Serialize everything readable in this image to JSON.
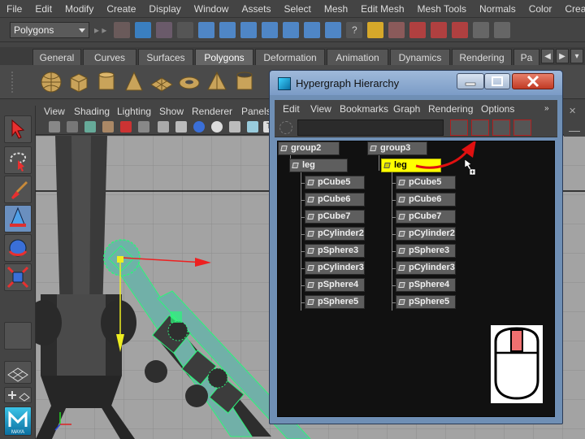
{
  "main_menu": [
    "File",
    "Edit",
    "Modify",
    "Create",
    "Display",
    "Window",
    "Assets",
    "Select",
    "Mesh",
    "Edit Mesh",
    "Mesh Tools",
    "Normals",
    "Color",
    "Create UVs"
  ],
  "status_line": {
    "menu_set": "Polygons"
  },
  "shelf": {
    "tabs": [
      "General",
      "Curves",
      "Surfaces",
      "Polygons",
      "Deformation",
      "Animation",
      "Dynamics",
      "Rendering",
      "Pa"
    ],
    "active_tab": "Polygons"
  },
  "viewport": {
    "menu": [
      "View",
      "Shading",
      "Lighting",
      "Show",
      "Renderer",
      "Panels"
    ]
  },
  "hypergraph": {
    "title": "Hypergraph Hierarchy",
    "menu": [
      "Edit",
      "View",
      "Bookmarks",
      "Graph",
      "Rendering",
      "Options"
    ],
    "left_tree": {
      "root": "group2",
      "child": "leg",
      "leaves": [
        "pCube5",
        "pCube6",
        "pCube7",
        "pCylinder2",
        "pSphere3",
        "pCylinder3",
        "pSphere4",
        "pSphere5"
      ]
    },
    "right_tree": {
      "root": "group3",
      "child": "leg",
      "leaves": [
        "pCube5",
        "pCube6",
        "pCube7",
        "pCylinder2",
        "pSphere3",
        "pCylinder3",
        "pSphere4",
        "pSphere5"
      ]
    }
  },
  "colors": {
    "selected_node": "#ffff00",
    "drag_arrow": "#e01010",
    "mouse_button_highlight": "#f07070"
  },
  "icons": {
    "mouse_hint": "mouse-middle-button-icon",
    "cursor": "move-cursor-icon"
  }
}
